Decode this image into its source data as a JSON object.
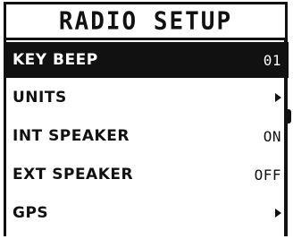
{
  "screen": {
    "title": "RADIO SETUP"
  },
  "menu": {
    "items": [
      {
        "label": "KEY BEEP",
        "value": "01",
        "selected": true
      },
      {
        "label": "UNITS",
        "value": "",
        "submenu": true
      },
      {
        "label": "INT SPEAKER",
        "value": "ON"
      },
      {
        "label": "EXT SPEAKER",
        "value": "OFF"
      },
      {
        "label": "GPS",
        "value": "",
        "submenu": true
      }
    ]
  },
  "colors": {
    "foreground": "#111111",
    "background": "#ffffff",
    "selection_background": "#111111",
    "selection_text": "#ffffff"
  },
  "icons": {
    "submenu": "arrow-right-icon"
  }
}
